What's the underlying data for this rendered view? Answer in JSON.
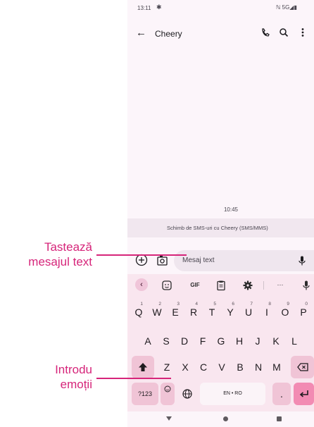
{
  "status_bar": {
    "time": "13:11",
    "network": "ℕ 5G◢▮"
  },
  "app_bar": {
    "title": "Cheery"
  },
  "conversation": {
    "timestamp": "10:45",
    "banner": "Schimb de SMS-uri cu Cheery (SMS/MMS)"
  },
  "compose": {
    "placeholder": "Mesaj text"
  },
  "keyboard": {
    "toolbar": {
      "gif": "GIF",
      "more": "···"
    },
    "row1": [
      {
        "k": "Q",
        "n": "1"
      },
      {
        "k": "W",
        "n": "2"
      },
      {
        "k": "E",
        "n": "3"
      },
      {
        "k": "R",
        "n": "4"
      },
      {
        "k": "T",
        "n": "5"
      },
      {
        "k": "Y",
        "n": "6"
      },
      {
        "k": "U",
        "n": "7"
      },
      {
        "k": "I",
        "n": "8"
      },
      {
        "k": "O",
        "n": "9"
      },
      {
        "k": "P",
        "n": "0"
      }
    ],
    "row2": [
      "A",
      "S",
      "D",
      "F",
      "G",
      "H",
      "J",
      "K",
      "L"
    ],
    "row3": [
      "Z",
      "X",
      "C",
      "V",
      "B",
      "N",
      "M"
    ],
    "symbols_label": "?123",
    "space_label": "EN • RO",
    "period_label": "."
  },
  "callouts": {
    "type_message": "Tastează\nmesajul text",
    "insert_emoji": "Introdu\nemoții"
  },
  "colors": {
    "accent": "#d6257a",
    "keyboard_bg": "#f9e6ef",
    "modifier_key": "#f0c4d6",
    "enter_key": "#f28bb3"
  }
}
